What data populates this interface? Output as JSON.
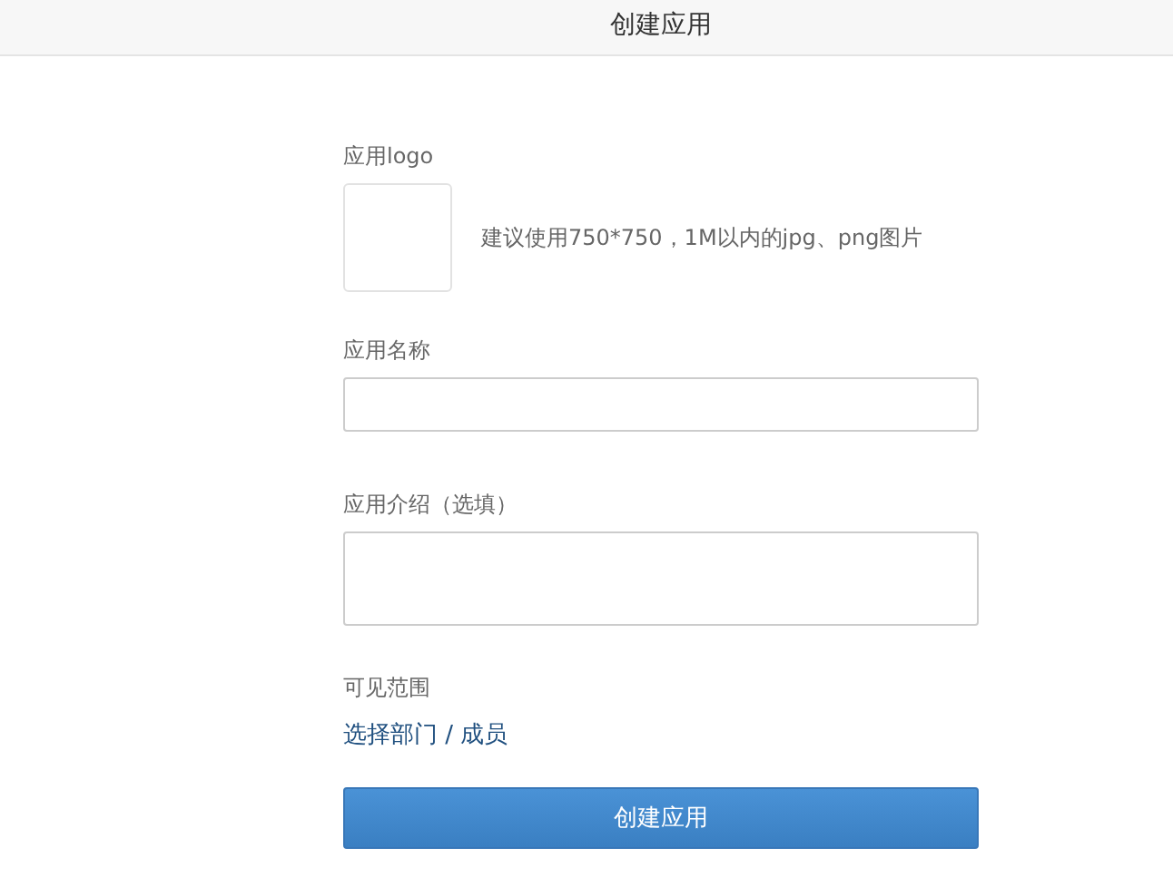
{
  "header": {
    "title": "创建应用"
  },
  "fields": [
    {
      "kind": "image",
      "label": "应用logo",
      "hint": "建议使用750*750，1M以内的jpg、png图片"
    },
    {
      "kind": "text",
      "label": "应用名称"
    },
    {
      "kind": "textarea",
      "label": "应用介绍（选填）"
    },
    {
      "kind": "link",
      "label": "可见范围",
      "link": "选择部门 / 成员"
    }
  ],
  "submit": "创建应用"
}
